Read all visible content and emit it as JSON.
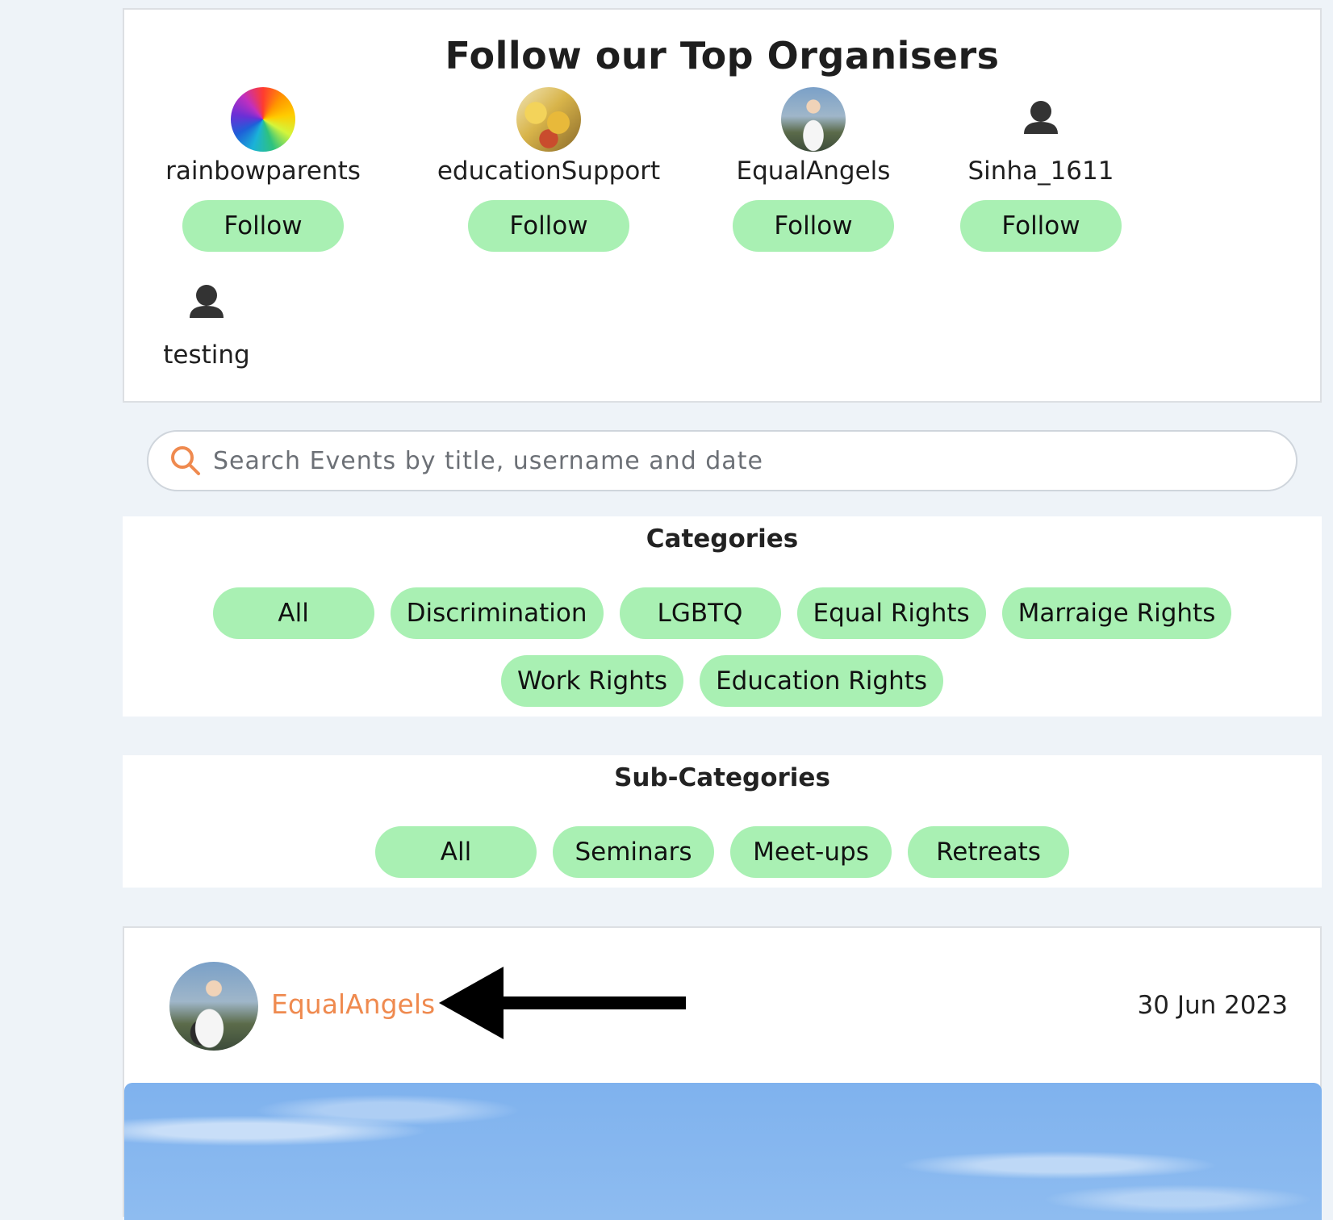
{
  "organisers": {
    "title": "Follow our Top Organisers",
    "follow_label": "Follow",
    "items": [
      {
        "name": "rainbowparents",
        "avatar": "rainbow-avatar"
      },
      {
        "name": "educationSupport",
        "avatar": "photo-avatar"
      },
      {
        "name": "EqualAngels",
        "avatar": "photo-avatar"
      },
      {
        "name": "Sinha_1611",
        "avatar": "person-icon"
      },
      {
        "name": "testing",
        "avatar": "person-icon"
      }
    ]
  },
  "search": {
    "placeholder": "Search Events by title, username and date",
    "icon": "search-icon",
    "icon_color": "#ef8a4f"
  },
  "categories": {
    "title": "Categories",
    "items": [
      "All",
      "Discrimination",
      "LGBTQ",
      "Equal Rights",
      "Marraige Rights",
      "Work Rights",
      "Education Rights"
    ]
  },
  "subcategories": {
    "title": "Sub-Categories",
    "items": [
      "All",
      "Seminars",
      "Meet-ups",
      "Retreats"
    ]
  },
  "event": {
    "username": "EqualAngels",
    "date": "30 Jun 2023"
  },
  "colors": {
    "chip": "#a9f0b3",
    "accent": "#ef8a4f",
    "background": "#eef3f8"
  }
}
